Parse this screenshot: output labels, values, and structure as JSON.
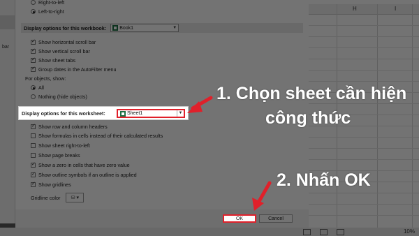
{
  "sidebar": {
    "partial_label": "bar"
  },
  "direction": {
    "right_to_left": "Right-to-left",
    "left_to_right": "Left-to-right"
  },
  "workbook_section": {
    "label": "Display options for this workbook:",
    "selected": "Book1",
    "options": [
      "Show horizontal scroll bar",
      "Show vertical scroll bar",
      "Show sheet tabs",
      "Group dates in the AutoFilter menu"
    ],
    "objects_label": "For objects, show:",
    "objects_all": "All",
    "objects_nothing": "Nothing (hide objects)"
  },
  "worksheet_section": {
    "label": "Display options for this worksheet:",
    "selected": "Sheet1",
    "options": [
      "Show row and column headers",
      "Show formulas in cells instead of their calculated results",
      "Show sheet right-to-left",
      "Show page breaks",
      "Show a zero in cells that have zero value",
      "Show outline symbols if an outline is applied",
      "Show gridlines"
    ],
    "gridline_color_label": "Gridline color"
  },
  "buttons": {
    "ok": "OK",
    "cancel": "Cancel"
  },
  "spreadsheet": {
    "columns": [
      "H",
      "I"
    ]
  },
  "statusbar": {
    "zoom": "10%"
  },
  "annotations": {
    "step1_line1": "1. Chọn sheet cần hiện",
    "step1_line2": "công thức",
    "step2": "2. Nhấn OK"
  },
  "colors": {
    "highlight": "#e0202a",
    "excel_green": "#1e7145"
  }
}
